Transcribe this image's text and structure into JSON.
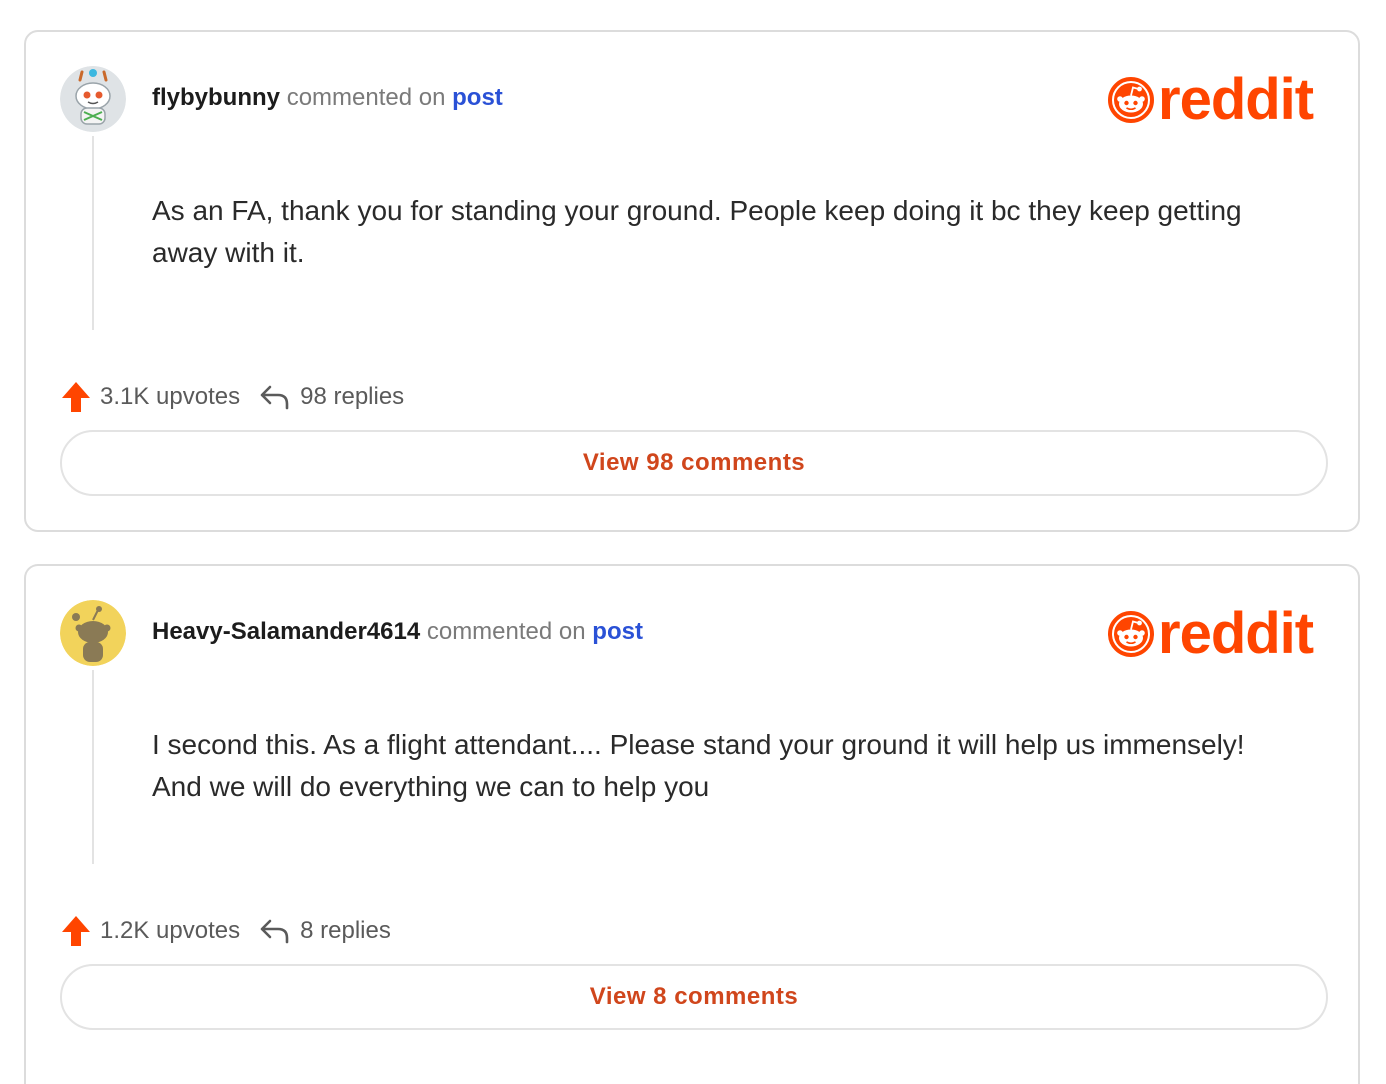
{
  "brand": {
    "name": "reddit",
    "color": "#ff4500"
  },
  "comments": [
    {
      "avatar": "snoo-avatar-icon",
      "username": "flybybunny",
      "action_text": "commented on",
      "link_text": "post",
      "body": "As an FA, thank you for standing your ground. People keep doing it bc they keep getting away with it.",
      "upvotes": "3.1K upvotes",
      "replies": "98 replies",
      "view_button": "View 98 comments"
    },
    {
      "avatar": "snoo-avatar-icon",
      "username": "Heavy-Salamander4614",
      "action_text": "commented on",
      "link_text": "post",
      "body": "I second this. As a flight attendant.... Please stand your ground it will help us immensely! And we will do everything we can to help you",
      "upvotes": "1.2K upvotes",
      "replies": "8 replies",
      "view_button": "View 8 comments"
    }
  ]
}
